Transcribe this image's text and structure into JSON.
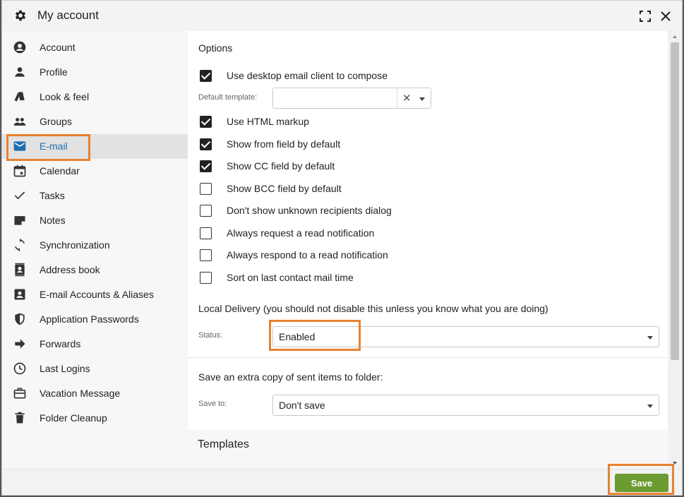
{
  "window": {
    "title": "My account"
  },
  "sidebar": {
    "items": [
      {
        "label": "Account",
        "icon": "account-circle-icon"
      },
      {
        "label": "Profile",
        "icon": "person-icon"
      },
      {
        "label": "Look & feel",
        "icon": "style-icon"
      },
      {
        "label": "Groups",
        "icon": "group-icon"
      },
      {
        "label": "E-mail",
        "icon": "mail-icon",
        "active": true
      },
      {
        "label": "Calendar",
        "icon": "calendar-icon"
      },
      {
        "label": "Tasks",
        "icon": "check-icon"
      },
      {
        "label": "Notes",
        "icon": "note-icon"
      },
      {
        "label": "Synchronization",
        "icon": "sync-icon"
      },
      {
        "label": "Address book",
        "icon": "contacts-icon"
      },
      {
        "label": "E-mail Accounts & Aliases",
        "icon": "account-box-icon"
      },
      {
        "label": "Application Passwords",
        "icon": "shield-icon"
      },
      {
        "label": "Forwards",
        "icon": "arrow-right-icon"
      },
      {
        "label": "Last Logins",
        "icon": "clock-icon"
      },
      {
        "label": "Vacation Message",
        "icon": "briefcase-icon"
      },
      {
        "label": "Folder Cleanup",
        "icon": "trash-icon"
      }
    ]
  },
  "options": {
    "title": "Options",
    "use_desktop_client": {
      "label": "Use desktop email client to compose",
      "checked": true
    },
    "default_template": {
      "label": "Default template:",
      "value": ""
    },
    "checkboxes": [
      {
        "label": "Use HTML markup",
        "checked": true
      },
      {
        "label": "Show from field by default",
        "checked": true
      },
      {
        "label": "Show CC field by default",
        "checked": true
      },
      {
        "label": "Show BCC field by default",
        "checked": false
      },
      {
        "label": "Don't show unknown recipients dialog",
        "checked": false
      },
      {
        "label": "Always request a read notification",
        "checked": false
      },
      {
        "label": "Always respond to a read notification",
        "checked": false
      },
      {
        "label": "Sort on last contact mail time",
        "checked": false
      }
    ]
  },
  "local_delivery": {
    "title": "Local Delivery (you should not disable this unless you know what you are doing)",
    "status_label": "Status:",
    "status_value": "Enabled"
  },
  "sent_copy": {
    "title": "Save an extra copy of sent items to folder:",
    "save_to_label": "Save to:",
    "save_to_value": "Don't save"
  },
  "templates": {
    "title": "Templates"
  },
  "footer": {
    "save_label": "Save"
  },
  "colors": {
    "accent": "#1f6fb2",
    "save": "#6b9b31",
    "highlight": "#e9822f"
  }
}
